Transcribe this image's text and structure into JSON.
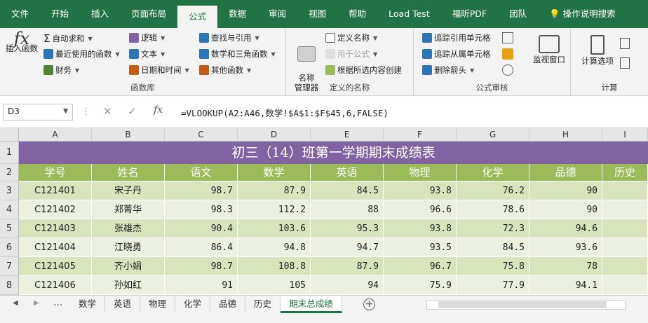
{
  "tabs": [
    "文件",
    "开始",
    "插入",
    "页面布局",
    "公式",
    "数据",
    "审阅",
    "视图",
    "帮助",
    "Load Test",
    "福昕PDF",
    "团队",
    "操作说明搜索"
  ],
  "ribbon": {
    "insert_function": "插入函数",
    "function_library": {
      "label": "函数库",
      "items": [
        "自动求和",
        "最近使用的函数",
        "财务",
        "逻辑",
        "文本",
        "日期和时间",
        "查找与引用",
        "数学和三角函数",
        "其他函数"
      ]
    },
    "defined_names": {
      "label": "定义的名称",
      "name_manager": "名称\n管理器",
      "items": [
        "定义名称",
        "用于公式",
        "根据所选内容创建"
      ]
    },
    "formula_auditing": {
      "label": "公式审核",
      "items": [
        "追踪引用单元格",
        "追踪从属单元格",
        "删除箭头"
      ],
      "watch_window": "监视窗口"
    },
    "calculation": {
      "label": "计算",
      "options": "计算选项"
    }
  },
  "formula_bar": {
    "name_box": "D3",
    "formula": "=VLOOKUP(A2:A46,数学!$A$1:$F$45,6,FALSE)"
  },
  "columns": [
    "A",
    "B",
    "C",
    "D",
    "E",
    "F",
    "G",
    "H",
    "I"
  ],
  "rows": [
    "1",
    "2",
    "3",
    "4",
    "5",
    "6",
    "7",
    "8"
  ],
  "sheet_title": "初三（14）班第一学期期末成绩表",
  "headers": [
    "学号",
    "姓名",
    "语文",
    "数学",
    "英语",
    "物理",
    "化学",
    "品德",
    "历史"
  ],
  "data_rows": [
    [
      "C121401",
      "宋子丹",
      "98.7",
      "87.9",
      "84.5",
      "93.8",
      "76.2",
      "90",
      ""
    ],
    [
      "C121402",
      "郑菁华",
      "98.3",
      "112.2",
      "88",
      "96.6",
      "78.6",
      "90",
      ""
    ],
    [
      "C121403",
      "张雄杰",
      "90.4",
      "103.6",
      "95.3",
      "93.8",
      "72.3",
      "94.6",
      ""
    ],
    [
      "C121404",
      "江晓勇",
      "86.4",
      "94.8",
      "94.7",
      "93.5",
      "84.5",
      "93.6",
      ""
    ],
    [
      "C121405",
      "齐小娟",
      "98.7",
      "108.8",
      "87.9",
      "96.7",
      "75.8",
      "78",
      ""
    ],
    [
      "C121406",
      "孙如红",
      "91",
      "105",
      "94",
      "75.9",
      "77.9",
      "94.1",
      ""
    ]
  ],
  "sheet_tabs": [
    "数学",
    "英语",
    "物理",
    "化学",
    "品德",
    "历史",
    "期末总成绩"
  ],
  "active_sheet": "期末总成绩",
  "colors": {
    "title_bg": "#8064a2",
    "header_bg": "#9bbb59",
    "odd_row": "#d8e4bc",
    "even_row": "#ebf1de",
    "accent": "#217346"
  }
}
